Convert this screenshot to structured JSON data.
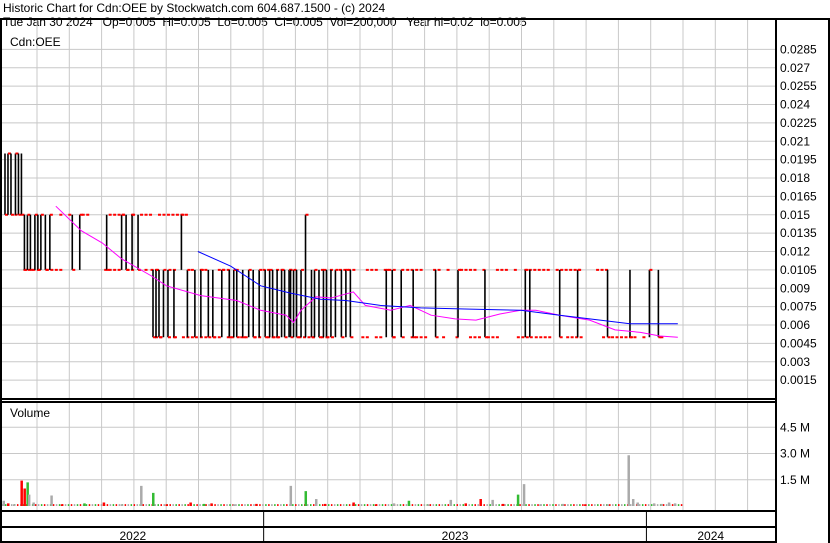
{
  "header": {
    "title": "Historic Chart for Cdn:OEE by Stockwatch.com 604.687.1500 - (c) 2024",
    "summary": "Tue Jan 30 2024   Op=0.005  Hi=0.005  Lo=0.005  Cl=0.005  Vol=200,000   Year hi=0.02  lo=0.005"
  },
  "chart_data": [
    {
      "type": "ohlc",
      "title": "Cdn:OEE",
      "x_unit": "trading day index",
      "xlim": [
        0,
        517
      ],
      "ylim": [
        0,
        0.03
      ],
      "yticks": [
        "0.0015",
        "0.003",
        "0.0045",
        "0.006",
        "0.0075",
        "0.009",
        "0.0105",
        "0.012",
        "0.0135",
        "0.015",
        "0.0165",
        "0.018",
        "0.0195",
        "0.021",
        "0.0225",
        "0.024",
        "0.0255",
        "0.027",
        "0.0285"
      ],
      "grid": true,
      "bars_high_low_close": [
        [
          2,
          0.02,
          0.015,
          0.015
        ],
        [
          4,
          0.02,
          0.015,
          0.02
        ],
        [
          6,
          0.02,
          0.015,
          0.015
        ],
        [
          9,
          0.02,
          0.015,
          0.02
        ],
        [
          11,
          0.02,
          0.015,
          0.015
        ],
        [
          13,
          0.02,
          0.015,
          0.015
        ],
        [
          15,
          0.015,
          0.0105,
          0.0105
        ],
        [
          17,
          0.015,
          0.0105,
          0.015
        ],
        [
          19,
          0.015,
          0.0105,
          0.0105
        ],
        [
          22,
          0.015,
          0.0105,
          0.015
        ],
        [
          24,
          0.015,
          0.0105,
          0.0105
        ],
        [
          26,
          0.015,
          0.0105,
          0.015
        ],
        [
          29,
          0.015,
          0.0105,
          0.0105
        ],
        [
          32,
          0.015,
          0.0105,
          0.015
        ],
        [
          47,
          0.015,
          0.0105,
          0.0105
        ],
        [
          52,
          0.015,
          0.0105,
          0.015
        ],
        [
          70,
          0.015,
          0.0105,
          0.0105
        ],
        [
          80,
          0.015,
          0.0105,
          0.015
        ],
        [
          83,
          0.015,
          0.0105,
          0.0105
        ],
        [
          87,
          0.015,
          0.0105,
          0.015
        ],
        [
          91,
          0.015,
          0.0105,
          0.0105
        ],
        [
          120,
          0.015,
          0.0105,
          0.015
        ],
        [
          101,
          0.0105,
          0.005,
          0.005
        ],
        [
          103,
          0.0105,
          0.005,
          0.0105
        ],
        [
          105,
          0.0105,
          0.005,
          0.005
        ],
        [
          108,
          0.0105,
          0.005,
          0.0105
        ],
        [
          111,
          0.0105,
          0.005,
          0.005
        ],
        [
          115,
          0.0105,
          0.005,
          0.005
        ],
        [
          124,
          0.0105,
          0.005,
          0.0105
        ],
        [
          129,
          0.0105,
          0.005,
          0.005
        ],
        [
          133,
          0.0105,
          0.005,
          0.0105
        ],
        [
          138,
          0.0105,
          0.005,
          0.005
        ],
        [
          141,
          0.0105,
          0.005,
          0.005
        ],
        [
          147,
          0.0105,
          0.005,
          0.0105
        ],
        [
          152,
          0.0105,
          0.005,
          0.005
        ],
        [
          155,
          0.0105,
          0.005,
          0.0105
        ],
        [
          157,
          0.0105,
          0.005,
          0.005
        ],
        [
          161,
          0.0105,
          0.005,
          0.005
        ],
        [
          165,
          0.0105,
          0.005,
          0.0105
        ],
        [
          168,
          0.0105,
          0.005,
          0.005
        ],
        [
          172,
          0.0105,
          0.005,
          0.0105
        ],
        [
          176,
          0.0105,
          0.005,
          0.005
        ],
        [
          179,
          0.0105,
          0.005,
          0.0105
        ],
        [
          181,
          0.0105,
          0.005,
          0.005
        ],
        [
          184,
          0.0105,
          0.005,
          0.005
        ],
        [
          187,
          0.0105,
          0.005,
          0.0105
        ],
        [
          189,
          0.0105,
          0.005,
          0.005
        ],
        [
          192,
          0.0105,
          0.005,
          0.0105
        ],
        [
          193,
          0.0105,
          0.005,
          0.005
        ],
        [
          195,
          0.0105,
          0.005,
          0.0105
        ],
        [
          197,
          0.0105,
          0.005,
          0.005
        ],
        [
          200,
          0.0105,
          0.005,
          0.0105
        ],
        [
          203,
          0.015,
          0.005,
          0.015
        ],
        [
          207,
          0.0105,
          0.005,
          0.005
        ],
        [
          209,
          0.0105,
          0.005,
          0.0105
        ],
        [
          212,
          0.0105,
          0.005,
          0.005
        ],
        [
          215,
          0.0105,
          0.005,
          0.0105
        ],
        [
          217,
          0.0105,
          0.005,
          0.005
        ],
        [
          220,
          0.0105,
          0.005,
          0.005
        ],
        [
          223,
          0.0105,
          0.005,
          0.0105
        ],
        [
          227,
          0.0105,
          0.005,
          0.005
        ],
        [
          230,
          0.0105,
          0.005,
          0.0105
        ],
        [
          233,
          0.0105,
          0.005,
          0.005
        ],
        [
          257,
          0.0105,
          0.005,
          0.0105
        ],
        [
          261,
          0.0105,
          0.005,
          0.005
        ],
        [
          267,
          0.0105,
          0.005,
          0.0105
        ],
        [
          275,
          0.0105,
          0.005,
          0.005
        ],
        [
          290,
          0.0105,
          0.005,
          0.005
        ],
        [
          305,
          0.0105,
          0.005,
          0.0105
        ],
        [
          323,
          0.0105,
          0.005,
          0.005
        ],
        [
          350,
          0.0105,
          0.005,
          0.0105
        ],
        [
          353,
          0.0105,
          0.005,
          0.005
        ],
        [
          373,
          0.0105,
          0.005,
          0.005
        ],
        [
          385,
          0.0105,
          0.005,
          0.0105
        ],
        [
          405,
          0.0105,
          0.005,
          0.005
        ],
        [
          420,
          0.0105,
          0.005,
          0.005
        ],
        [
          433,
          0.0105,
          0.005,
          0.0105
        ],
        [
          439,
          0.0105,
          0.005,
          0.005
        ]
      ],
      "flat_days": [
        [
          0,
          14,
          0.015
        ],
        [
          15,
          100,
          0.0105
        ],
        [
          36,
          125,
          0.015
        ],
        [
          100,
          345,
          0.0105
        ],
        [
          100,
          345,
          0.005
        ],
        [
          345,
          445,
          0.005
        ],
        [
          350,
          410,
          0.0105
        ]
      ],
      "series": [
        {
          "name": "short moving average",
          "color": "#ff00ff",
          "points": [
            [
              36,
              0.0157
            ],
            [
              53,
              0.0137
            ],
            [
              67,
              0.0127
            ],
            [
              80,
              0.0114
            ],
            [
              100,
              0.01
            ],
            [
              110,
              0.0092
            ],
            [
              133,
              0.0084
            ],
            [
              157,
              0.008
            ],
            [
              173,
              0.0072
            ],
            [
              190,
              0.0068
            ],
            [
              195,
              0.0062
            ],
            [
              200,
              0.0072
            ],
            [
              210,
              0.0083
            ],
            [
              220,
              0.0082
            ],
            [
              235,
              0.0087
            ],
            [
              243,
              0.0076
            ],
            [
              260,
              0.0072
            ],
            [
              273,
              0.0076
            ],
            [
              287,
              0.0068
            ],
            [
              303,
              0.0065
            ],
            [
              317,
              0.0064
            ],
            [
              333,
              0.0069
            ],
            [
              347,
              0.0072
            ],
            [
              357,
              0.0072
            ],
            [
              373,
              0.0068
            ],
            [
              393,
              0.0064
            ],
            [
              410,
              0.0056
            ],
            [
              427,
              0.0054
            ],
            [
              440,
              0.0051
            ],
            [
              452,
              0.005
            ]
          ]
        },
        {
          "name": "long moving average",
          "color": "#0000ff",
          "points": [
            [
              131,
              0.012
            ],
            [
              153,
              0.0108
            ],
            [
              173,
              0.0092
            ],
            [
              193,
              0.0086
            ],
            [
              213,
              0.0081
            ],
            [
              230,
              0.008
            ],
            [
              253,
              0.0076
            ],
            [
              280,
              0.0074
            ],
            [
              313,
              0.0073
            ],
            [
              347,
              0.0072
            ],
            [
              373,
              0.0068
            ],
            [
              400,
              0.0064
            ],
            [
              420,
              0.0061
            ],
            [
              452,
              0.0061
            ]
          ]
        }
      ]
    },
    {
      "type": "bar",
      "title": "Volume",
      "ylim": [
        0,
        6
      ],
      "y_unit": "M shares",
      "yticks": [
        "1.5 M",
        "3.0 M",
        "4.5 M"
      ],
      "bars_day_volume_color": [
        [
          1,
          0.3,
          "gray"
        ],
        [
          4,
          0.15,
          "red"
        ],
        [
          8,
          0.1,
          "gray"
        ],
        [
          13,
          1.45,
          "red"
        ],
        [
          15,
          1.0,
          "red"
        ],
        [
          17,
          1.35,
          "green"
        ],
        [
          18,
          0.65,
          "gray"
        ],
        [
          21,
          0.2,
          "gray"
        ],
        [
          33,
          0.6,
          "gray"
        ],
        [
          40,
          0.1,
          "red"
        ],
        [
          55,
          0.15,
          "green"
        ],
        [
          68,
          0.2,
          "red"
        ],
        [
          80,
          0.1,
          "gray"
        ],
        [
          93,
          1.15,
          "gray"
        ],
        [
          101,
          0.75,
          "green"
        ],
        [
          110,
          0.1,
          "red"
        ],
        [
          126,
          0.2,
          "red"
        ],
        [
          135,
          0.12,
          "green"
        ],
        [
          140,
          0.15,
          "red"
        ],
        [
          155,
          0.1,
          "gray"
        ],
        [
          170,
          0.12,
          "red"
        ],
        [
          193,
          1.15,
          "gray"
        ],
        [
          203,
          0.85,
          "green"
        ],
        [
          210,
          0.4,
          "gray"
        ],
        [
          216,
          0.12,
          "red"
        ],
        [
          235,
          0.2,
          "red"
        ],
        [
          250,
          0.1,
          "red"
        ],
        [
          262,
          0.15,
          "gray"
        ],
        [
          272,
          0.3,
          "green"
        ],
        [
          285,
          0.1,
          "gray"
        ],
        [
          300,
          0.35,
          "gray"
        ],
        [
          310,
          0.15,
          "red"
        ],
        [
          320,
          0.4,
          "red"
        ],
        [
          328,
          0.35,
          "gray"
        ],
        [
          335,
          0.12,
          "red"
        ],
        [
          345,
          0.65,
          "green"
        ],
        [
          349,
          1.25,
          "gray"
        ],
        [
          360,
          0.1,
          "gray"
        ],
        [
          375,
          0.12,
          "gray"
        ],
        [
          390,
          0.1,
          "red"
        ],
        [
          405,
          0.1,
          "gray"
        ],
        [
          419,
          2.9,
          "gray"
        ],
        [
          422,
          0.4,
          "gray"
        ],
        [
          425,
          0.2,
          "gray"
        ],
        [
          436,
          0.15,
          "gray"
        ],
        [
          441,
          0.12,
          "gray"
        ],
        [
          446,
          0.2,
          "gray"
        ],
        [
          450,
          0.15,
          "gray"
        ]
      ]
    }
  ],
  "x_axis": {
    "years": [
      {
        "label": "2022",
        "start": 0,
        "end": 175
      },
      {
        "label": "2023",
        "start": 175,
        "end": 431
      },
      {
        "label": "2024",
        "start": 431,
        "end": 517
      }
    ]
  },
  "colors": {
    "grid": "#c8c8c8",
    "bar": "#000000",
    "close_tick": "#ff0000",
    "vol_up": "#33bb33",
    "vol_down": "#ff0000",
    "vol_flat": "#aaaaaa"
  }
}
